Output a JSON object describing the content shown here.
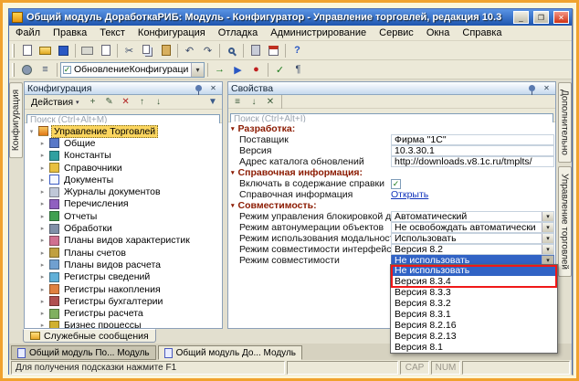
{
  "window": {
    "title": "Общий модуль ДоработкаРИБ: Модуль - Конфигуратор - Управление торговлей, редакция 10.3",
    "buttons": {
      "minimize": "_",
      "maximize": "❐",
      "close": "✕"
    }
  },
  "menu": [
    "Файл",
    "Правка",
    "Текст",
    "Конфигурация",
    "Отладка",
    "Администрирование",
    "Сервис",
    "Окна",
    "Справка"
  ],
  "toolbar": {
    "module_combo": "ОбновлениеКонфигурации"
  },
  "left_tab": "Конфигурация",
  "config_panel": {
    "title": "Конфигурация",
    "actions_button": "Действия",
    "search_placeholder": "Поиск (Ctrl+Alt+М)",
    "tree": [
      {
        "label": "Управление Торговлей",
        "icon": "configuration-icon",
        "level": 0,
        "selected": true
      },
      {
        "label": "Общие",
        "icon": "common-icon",
        "level": 1
      },
      {
        "label": "Константы",
        "icon": "constants-icon",
        "level": 1
      },
      {
        "label": "Справочники",
        "icon": "catalogs-icon",
        "level": 1
      },
      {
        "label": "Документы",
        "icon": "documents-icon",
        "level": 1
      },
      {
        "label": "Журналы документов",
        "icon": "journals-icon",
        "level": 1
      },
      {
        "label": "Перечисления",
        "icon": "enums-icon",
        "level": 1
      },
      {
        "label": "Отчеты",
        "icon": "reports-icon",
        "level": 1
      },
      {
        "label": "Обработки",
        "icon": "dataprocessors-icon",
        "level": 1
      },
      {
        "label": "Планы видов характеристик",
        "icon": "chart-kinds-icon",
        "level": 1
      },
      {
        "label": "Планы счетов",
        "icon": "chart-accounts-icon",
        "level": 1
      },
      {
        "label": "Планы видов расчета",
        "icon": "calc-kinds-icon",
        "level": 1
      },
      {
        "label": "Регистры сведений",
        "icon": "info-registers-icon",
        "level": 1
      },
      {
        "label": "Регистры накопления",
        "icon": "accum-registers-icon",
        "level": 1
      },
      {
        "label": "Регистры бухгалтерии",
        "icon": "accounting-registers-icon",
        "level": 1
      },
      {
        "label": "Регистры расчета",
        "icon": "calc-registers-icon",
        "level": 1
      },
      {
        "label": "Бизнес процессы",
        "icon": "business-processes-icon",
        "level": 1
      }
    ]
  },
  "service_tab": "Служебные сообщения",
  "properties_panel": {
    "title": "Свойства",
    "search_placeholder": "Поиск (Ctrl+Alt+I)",
    "sections": [
      {
        "title": "Разработка:",
        "rows": [
          {
            "label": "Поставщик",
            "value": "Фирма \"1С\"",
            "type": "text"
          },
          {
            "label": "Версия",
            "value": "10.3.30.1",
            "type": "text"
          },
          {
            "label": "Адрес каталога обновлений",
            "value": "http://downloads.v8.1c.ru/tmplts/",
            "type": "text"
          }
        ]
      },
      {
        "title": "Справочная информация:",
        "rows": [
          {
            "label": "Включать в содержание справки",
            "type": "checkbox",
            "checked": true
          },
          {
            "label": "Справочная информация",
            "value": "Открыть",
            "type": "link"
          }
        ]
      },
      {
        "title": "Совместимость:",
        "rows": [
          {
            "label": "Режим управления блокировкой данных",
            "value": "Автоматический",
            "type": "combo"
          },
          {
            "label": "Режим автонумерации объектов",
            "value": "Не освобождать автоматически",
            "type": "combo"
          },
          {
            "label": "Режим использования модальности",
            "value": "Использовать",
            "type": "combo"
          },
          {
            "label": "Режим совместимости интерфейса",
            "value": "Версия 8.2",
            "type": "combo"
          },
          {
            "label": "Режим совместимости",
            "value": "Не использовать",
            "type": "combo",
            "open": true
          }
        ]
      }
    ]
  },
  "compat_dropdown": {
    "items": [
      "Не использовать",
      "Версия 8.3.4",
      "Версия 8.3.3",
      "Версия 8.3.2",
      "Версия 8.3.1",
      "Версия 8.2.16",
      "Версия 8.2.13",
      "Версия 8.1"
    ],
    "selected_index": 0,
    "annotation_color": "#f01818"
  },
  "right_tabs": [
    "Дополнительно",
    "Управление торговлей"
  ],
  "window_tabs": [
    {
      "label": "Общий модуль По... Модуль",
      "active": false
    },
    {
      "label": "Общий модуль До... Модуль",
      "active": true
    }
  ],
  "status_bar": {
    "hint": "Для получения подсказки нажмите F1",
    "caps": "CAP",
    "num": "NUM"
  }
}
